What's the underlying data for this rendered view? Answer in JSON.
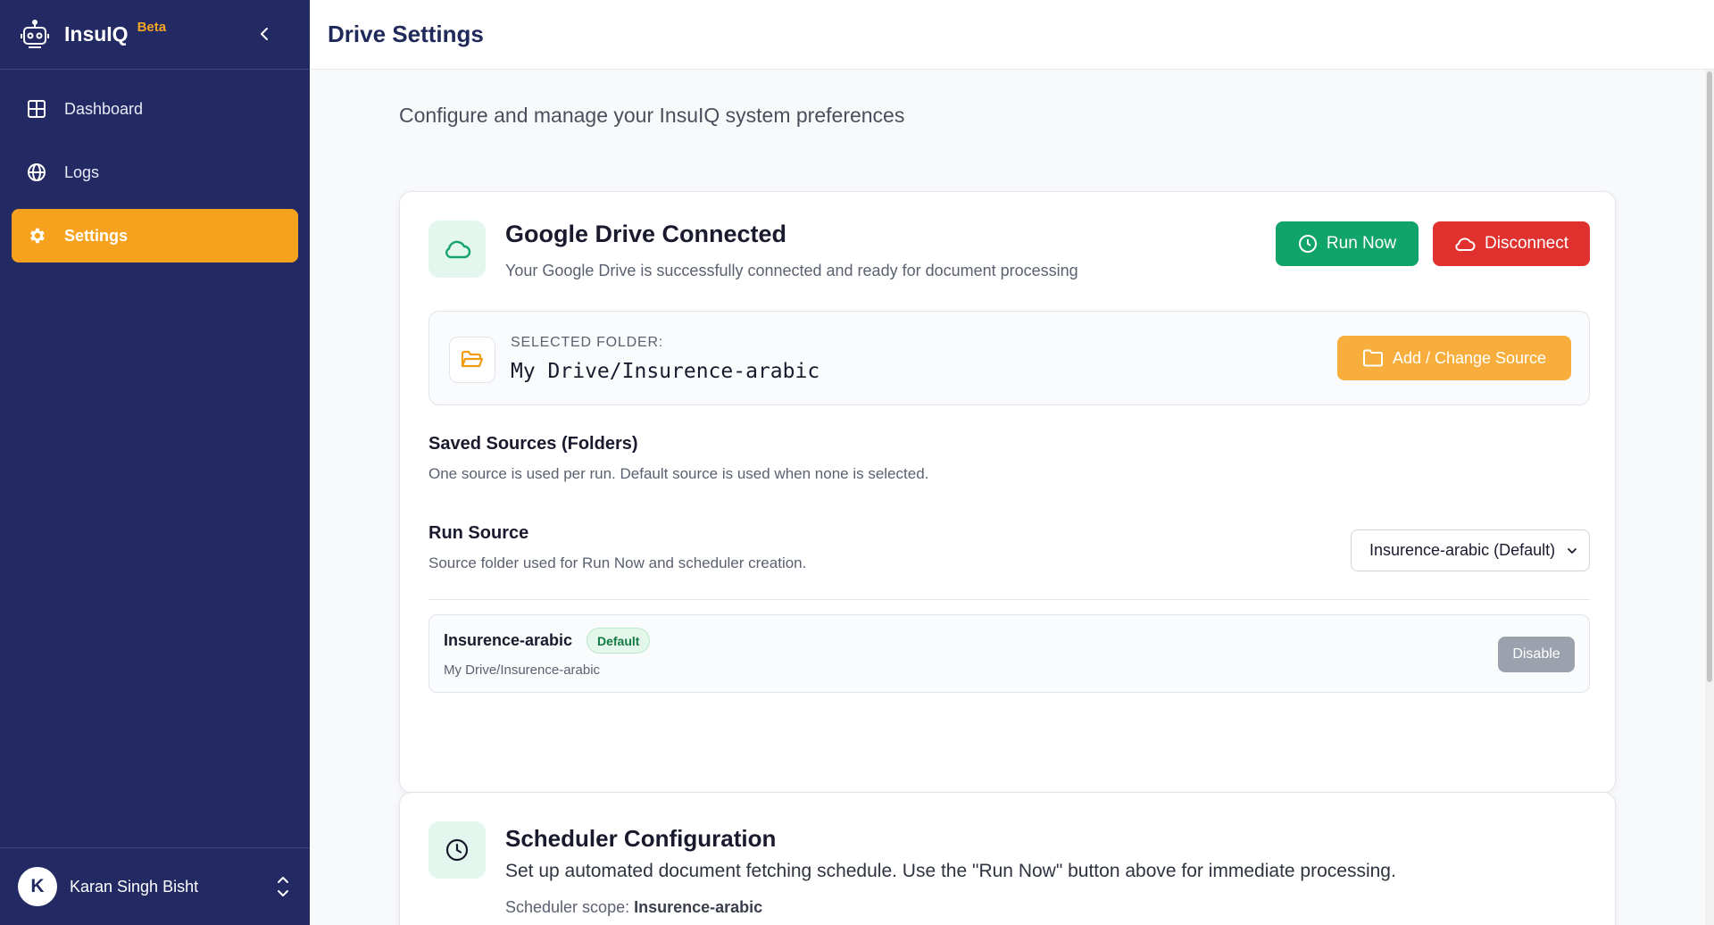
{
  "brand": {
    "name": "InsuIQ",
    "badge": "Beta"
  },
  "sidebar": {
    "items": [
      {
        "label": "Dashboard",
        "icon": "grid-icon"
      },
      {
        "label": "Logs",
        "icon": "globe-icon"
      },
      {
        "label": "Settings",
        "icon": "gear-icon",
        "active": true
      }
    ]
  },
  "user": {
    "initial": "K",
    "name": "Karan Singh Bisht"
  },
  "header": {
    "title": "Drive Settings"
  },
  "page": {
    "subtitle": "Configure and manage your InsuIQ system preferences"
  },
  "drive": {
    "title": "Google Drive Connected",
    "description": "Your Google Drive is successfully connected and ready for document processing",
    "run_now_label": "Run Now",
    "disconnect_label": "Disconnect",
    "folder_label": "SELECTED FOLDER:",
    "folder_path": "My Drive/Insurence-arabic",
    "change_source_label": "Add / Change Source",
    "saved_sources_title": "Saved Sources (Folders)",
    "saved_sources_desc": "One source is used per run. Default source is used when none is selected.",
    "run_source_title": "Run Source",
    "run_source_desc": "Source folder used for Run Now and scheduler creation.",
    "run_source_selected": "Insurence-arabic (Default)",
    "sources": [
      {
        "name": "Insurence-arabic",
        "badge": "Default",
        "path": "My Drive/Insurence-arabic",
        "action": "Disable"
      }
    ]
  },
  "scheduler": {
    "title": "Scheduler Configuration",
    "description": "Set up automated document fetching schedule. Use the \"Run Now\" button above for immediate processing.",
    "scope_label": "Scheduler scope:",
    "scope_value": "Insurence-arabic"
  },
  "colors": {
    "sidebar_bg": "#232a63",
    "accent": "#f7a21e",
    "run_green": "#10a36a",
    "disconnect_red": "#e0312f"
  }
}
